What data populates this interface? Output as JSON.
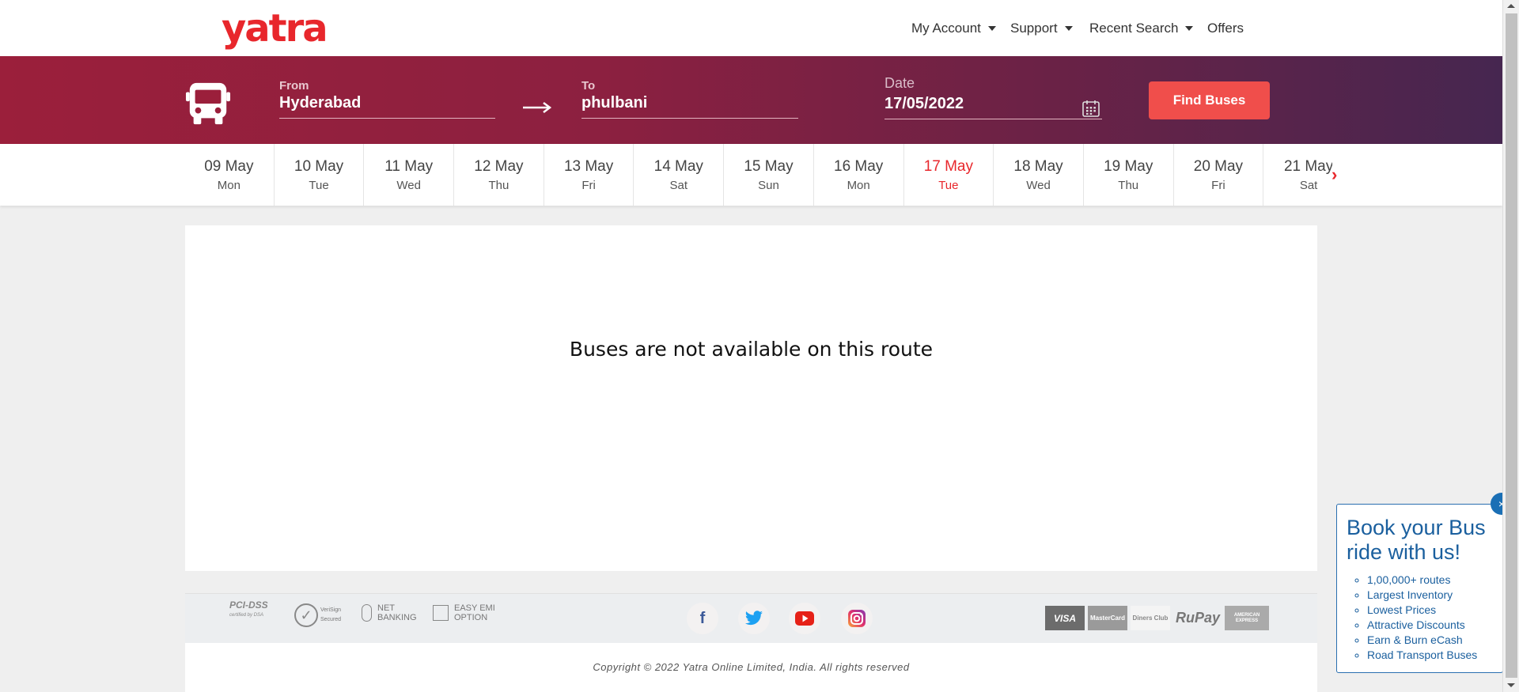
{
  "brand": {
    "logo_text": "yatra",
    "accent": "#e8272c"
  },
  "nav": [
    {
      "label": "My Account",
      "has_dropdown": true
    },
    {
      "label": "Support",
      "has_dropdown": true
    },
    {
      "label": "Recent Search",
      "has_dropdown": true
    },
    {
      "label": "Offers",
      "has_dropdown": false
    }
  ],
  "search": {
    "from_label": "From",
    "from_value": "Hyderabad",
    "to_label": "To",
    "to_value": "phulbani",
    "date_label": "Date",
    "date_value": "17/05/2022",
    "find_button": "Find Buses",
    "button_color": "#f04e4b"
  },
  "dates": [
    {
      "date": "09 May",
      "day": "Mon"
    },
    {
      "date": "10 May",
      "day": "Tue"
    },
    {
      "date": "11 May",
      "day": "Wed"
    },
    {
      "date": "12 May",
      "day": "Thu"
    },
    {
      "date": "13 May",
      "day": "Fri"
    },
    {
      "date": "14 May",
      "day": "Sat"
    },
    {
      "date": "15 May",
      "day": "Sun"
    },
    {
      "date": "16 May",
      "day": "Mon"
    },
    {
      "date": "17 May",
      "day": "Tue",
      "selected": true
    },
    {
      "date": "18 May",
      "day": "Wed"
    },
    {
      "date": "19 May",
      "day": "Thu"
    },
    {
      "date": "20 May",
      "day": "Fri"
    },
    {
      "date": "21 May",
      "day": "Sat"
    }
  ],
  "main": {
    "message": "Buses are not available on this route"
  },
  "footer": {
    "badges": {
      "pci": "PCI-DSS",
      "pci_sub": "certified by DSA",
      "verisign": "VeriSign Secured",
      "net_banking": "NET BANKING",
      "easy_emi": "EASY EMI OPTION"
    },
    "social": [
      "facebook-icon",
      "twitter-icon",
      "youtube-icon",
      "instagram-icon"
    ],
    "payments": {
      "visa": "VISA",
      "mastercard": "MasterCard",
      "diners": "Diners Club",
      "rupay": "RuPay",
      "amex": "AMERICAN EXPRESS"
    },
    "copyright": "Copyright © 2022 Yatra Online Limited, India. All rights reserved"
  },
  "promo": {
    "title": "Book your Bus ride with us!",
    "items": [
      "1,00,000+ routes",
      "Largest Inventory",
      "Lowest Prices",
      "Attractive Discounts",
      "Earn & Burn eCash",
      "Road Transport Buses"
    ]
  }
}
